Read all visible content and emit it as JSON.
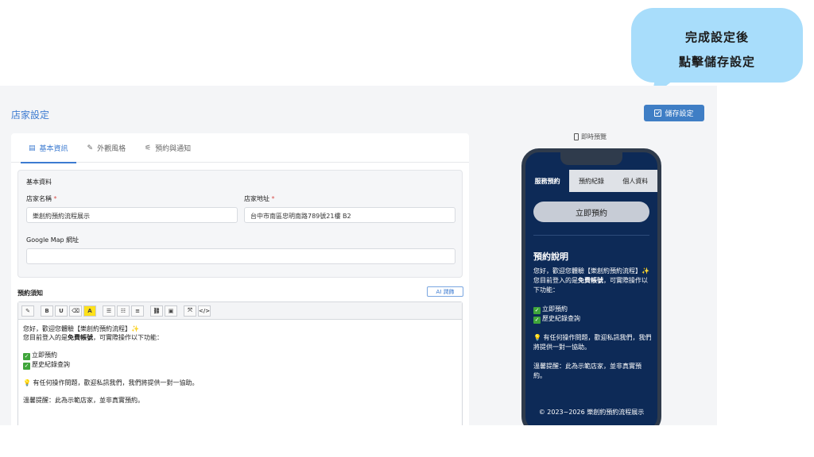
{
  "callout": {
    "line1": "完成設定後",
    "line2": "點擊儲存設定"
  },
  "header": {
    "title": "店家設定",
    "save_label": "儲存設定"
  },
  "tabs": [
    {
      "icon": "▤",
      "label": "基本資訊"
    },
    {
      "icon": "✎",
      "label": "外觀風格"
    },
    {
      "icon": "⚟",
      "label": "預約與通知"
    }
  ],
  "basic": {
    "section_title": "基本資料",
    "store_name_label": "店家名稱",
    "store_name_value": "樂創約預約流程展示",
    "address_label": "店家地址",
    "address_value": "台中市南區忠明南路789號21樓 B2",
    "map_label": "Google Map 網址",
    "map_value": "",
    "required_mark": "*"
  },
  "notice": {
    "title": "預約須知",
    "ai_label": "AI 潤飾",
    "toolbar": [
      "✎",
      "B",
      "U",
      "⌫",
      "A",
      "☰",
      "☷",
      "≡",
      "⛓",
      "▣",
      "⤧",
      "</>"
    ],
    "greeting": "您好，歡迎您體驗【樂創約預約流程】✨",
    "login_prefix": "您目前登入的是",
    "login_bold": "免費帳號",
    "login_suffix": "，可實際操作以下功能：",
    "item1": "立即預約",
    "item2": "歷史紀錄查詢",
    "help": "有任何操作問題，歡迎私訊我們，我們將提供一對一協助。",
    "reminder": "溫馨提醒：此為示範店家，並非真實預約。"
  },
  "preview": {
    "label": "即時預覽",
    "tabs": [
      "服務預約",
      "預約紀錄",
      "個人資料"
    ],
    "book_label": "立即預約",
    "info_title": "預約說明",
    "greeting": "您好，歡迎您體驗【樂創約預約流程】✨",
    "login_prefix": "您目前登入的是",
    "login_bold": "免費帳號",
    "login_suffix": "，可實際操作以下功能：",
    "item1": "立即預約",
    "item2": "歷史紀錄查詢",
    "help": "有任何操作問題，歡迎私訊我們，我們將提供一對一協助。",
    "reminder": "溫馨提醒：此為示範店家，並非真實預約。",
    "footer": "© 2023~2026 樂創約預約流程展示"
  },
  "colors": {
    "accent": "#3c7bd1",
    "phone_bg": "#0d2a57",
    "callout": "#a8ddfb"
  }
}
